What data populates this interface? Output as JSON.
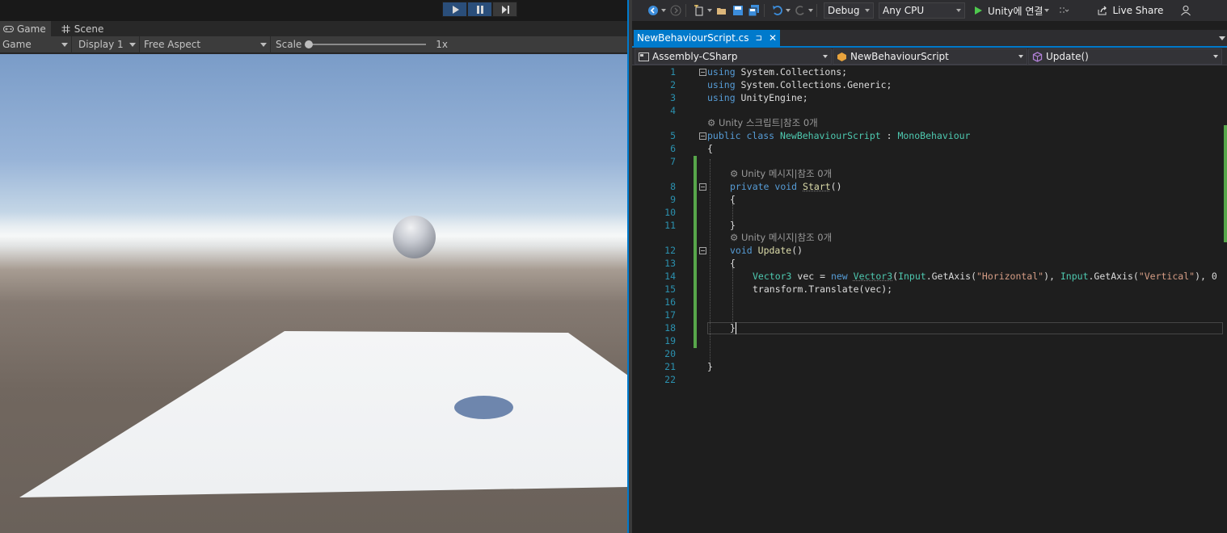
{
  "unity": {
    "tabs": [
      {
        "label": "Game",
        "icon": "gamepad-icon"
      },
      {
        "label": "Scene",
        "icon": "grid-icon"
      }
    ],
    "toolbar": {
      "mode": "Game",
      "display": "Display 1",
      "aspect": "Free Aspect",
      "scale_label": "Scale",
      "scale_value": "1x"
    }
  },
  "vs": {
    "toolbar": {
      "config": "Debug",
      "platform": "Any CPU",
      "run_label": "Unity에 연결",
      "live_share": "Live Share"
    },
    "doc_tab": {
      "label": "NewBehaviourScript.cs",
      "pin": "⊐",
      "close": "✕"
    },
    "nav": {
      "project": "Assembly-CSharp",
      "type": "NewBehaviourScript",
      "member": "Update()"
    },
    "line_numbers": [
      "1",
      "2",
      "3",
      "4",
      "5",
      "6",
      "7",
      "8",
      "9",
      "10",
      "11",
      "12",
      "13",
      "14",
      "15",
      "16",
      "17",
      "18",
      "19",
      "20",
      "21",
      "22"
    ],
    "code": {
      "l1": [
        "using",
        " System.Collections;"
      ],
      "l2": [
        "using",
        " System.Collections.Generic;"
      ],
      "l3": [
        "using",
        " UnityEngine;"
      ],
      "lens_class": "Unity 스크립트|참조 0개",
      "l5": [
        "public",
        " ",
        "class",
        " ",
        "NewBehaviourScript",
        " : ",
        "MonoBehaviour"
      ],
      "l6": "{",
      "lens_start": "Unity 메시지|참조 0개",
      "l8": [
        "private",
        " ",
        "void",
        " ",
        "Start",
        "()"
      ],
      "l9": "{",
      "l11": "}",
      "lens_update": "Unity 메시지|참조 0개",
      "l12": [
        "void",
        " ",
        "Update",
        "()"
      ],
      "l13": "{",
      "l14": [
        "Vector3",
        " vec = ",
        "new",
        " ",
        "Vector3",
        "(",
        "Input",
        ".GetAxis(",
        "\"Horizontal\"",
        "), ",
        "Input",
        ".GetAxis(",
        "\"Vertical\"",
        "), 0"
      ],
      "l15": "transform.Translate(vec);",
      "l18": "}",
      "l21": "}"
    }
  }
}
